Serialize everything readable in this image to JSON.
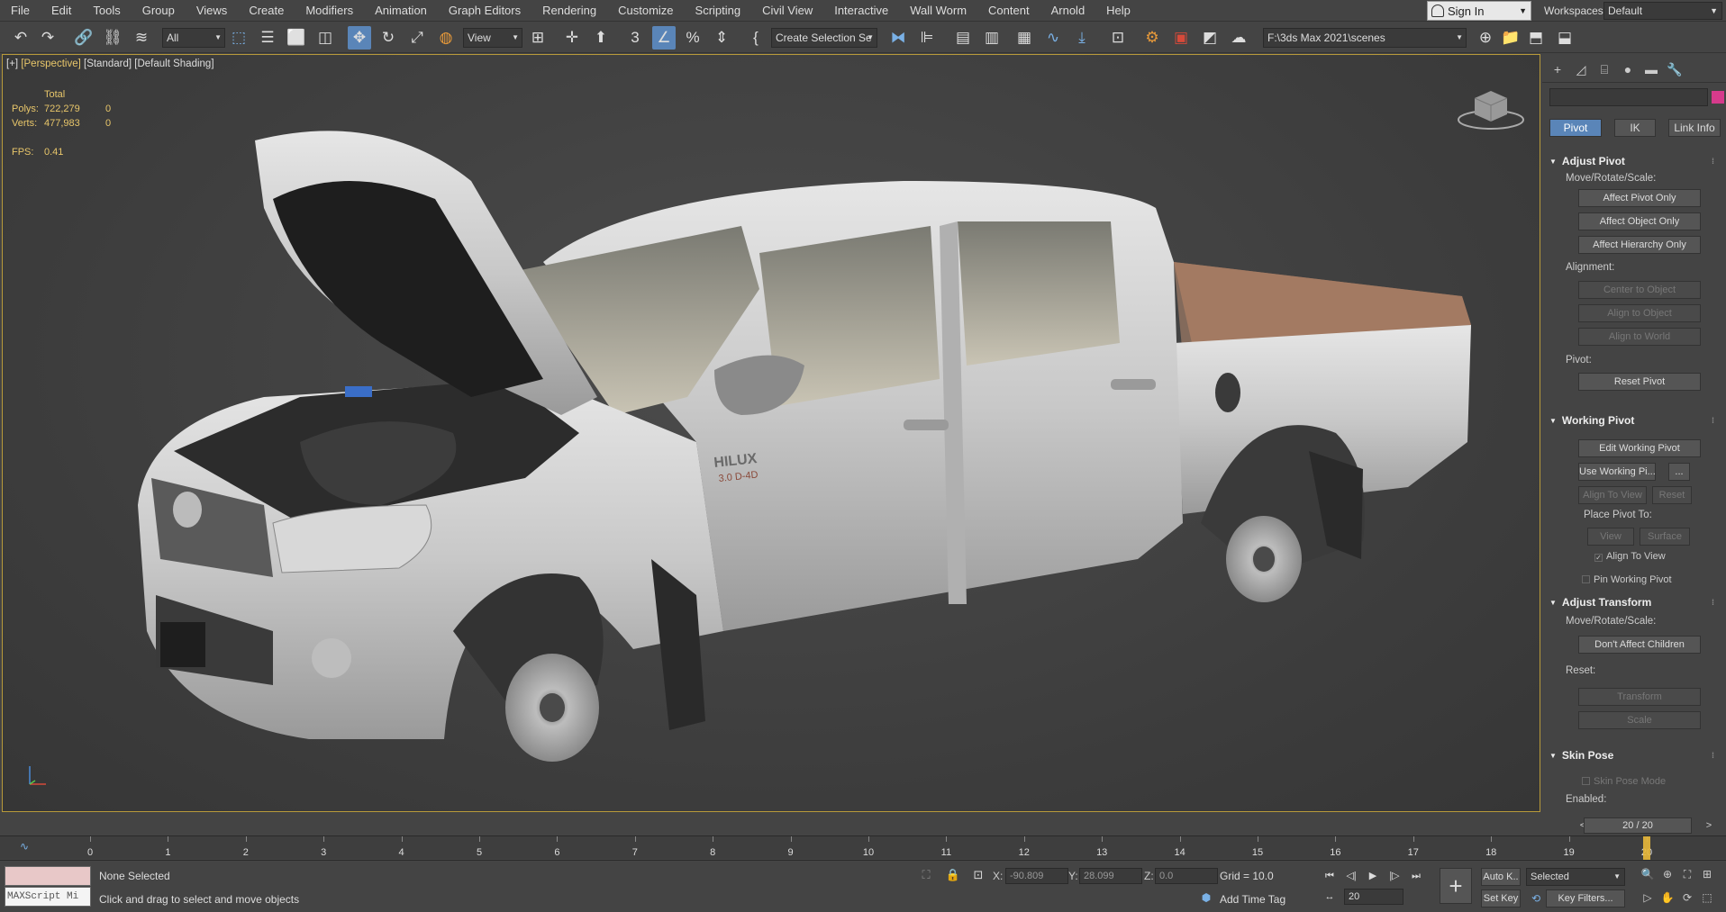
{
  "menu": {
    "items": [
      "File",
      "Edit",
      "Tools",
      "Group",
      "Views",
      "Create",
      "Modifiers",
      "Animation",
      "Graph Editors",
      "Rendering",
      "Customize",
      "Scripting",
      "Civil View",
      "Interactive",
      "Wall Worm",
      "Content",
      "Arnold",
      "Help"
    ],
    "sign_in": "Sign In",
    "workspaces_label": "Workspaces:",
    "workspace_value": "Default"
  },
  "toolbar": {
    "filter_value": "All",
    "ref_coord_value": "View",
    "selection_set_value": "Create Selection Se",
    "project_path": "F:\\3ds Max 2021\\scenes"
  },
  "viewport": {
    "label_plus": "[+]",
    "label_view": "[Perspective]",
    "label_shading_std": "[Standard]",
    "label_shading": "[Default Shading]",
    "stats": {
      "total_label": "Total",
      "polys_label": "Polys:",
      "polys_total": "722,279",
      "polys_sel": "0",
      "verts_label": "Verts:",
      "verts_total": "477,983",
      "verts_sel": "0",
      "fps_label": "FPS:",
      "fps_value": "0.41"
    }
  },
  "command_panel": {
    "hierarchy_tabs": [
      "Pivot",
      "IK",
      "Link Info"
    ],
    "adjust_pivot": {
      "title": "Adjust Pivot",
      "move_label": "Move/Rotate/Scale:",
      "buttons": [
        "Affect Pivot Only",
        "Affect Object Only",
        "Affect Hierarchy Only"
      ],
      "alignment_label": "Alignment:",
      "align_buttons": [
        "Center to Object",
        "Align to Object",
        "Align to World"
      ],
      "pivot_label": "Pivot:",
      "reset_pivot": "Reset Pivot"
    },
    "working_pivot": {
      "title": "Working Pivot",
      "edit_btn": "Edit Working Pivot",
      "use_btn": "Use Working Pi...",
      "more_btn": "...",
      "align_view_btn": "Align To View",
      "reset_btn": "Reset",
      "place_label": "Place Pivot To:",
      "view_btn": "View",
      "surface_btn": "Surface",
      "align_to_view_chk": "Align To View",
      "pin_chk": "Pin Working Pivot"
    },
    "adjust_transform": {
      "title": "Adjust Transform",
      "move_label": "Move/Rotate/Scale:",
      "dont_affect": "Don't Affect Children",
      "reset_label": "Reset:",
      "transform_btn": "Transform",
      "scale_btn": "Scale"
    },
    "skin_pose": {
      "title": "Skin Pose",
      "mode_chk": "Skin Pose Mode",
      "enabled_label": "Enabled:"
    },
    "frame_counter": "20 / 20"
  },
  "timeline": {
    "ticks": [
      "0",
      "1",
      "2",
      "3",
      "4",
      "5",
      "6",
      "7",
      "8",
      "9",
      "10",
      "11",
      "12",
      "13",
      "14",
      "15",
      "16",
      "17",
      "18",
      "19",
      "20"
    ],
    "current_frame_fraction": 1.0
  },
  "status": {
    "maxscript_placeholder": "MAXScript Mi",
    "selection": "None Selected",
    "prompt": "Click and drag to select and move objects",
    "x_label": "X:",
    "x_value": "-90.809",
    "y_label": "Y:",
    "y_value": "28.099",
    "z_label": "Z:",
    "z_value": "0.0",
    "grid": "Grid = 10.0",
    "add_time_tag": "Add Time Tag",
    "frame_value": "20",
    "auto_key": "Auto K..",
    "set_key": "Set Key",
    "selected_dd": "Selected",
    "key_filters": "Key Filters..."
  },
  "colors": {
    "accent": "#5a85b8",
    "viewport_border": "#b89a3a",
    "stats_text": "#e8c66a",
    "object_color": "#d63b8c"
  }
}
